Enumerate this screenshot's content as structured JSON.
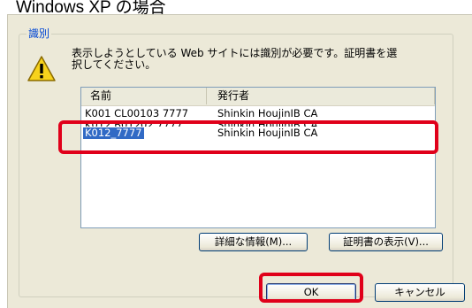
{
  "caption": "Windows XP の場合",
  "dialog": {
    "group_title": "識別",
    "message": "表示しようとしている Web サイトには識別が必要です。証明書を選択してください。",
    "icon": "warning-icon",
    "columns": [
      "名前",
      "発行者"
    ],
    "certificates": [
      {
        "name": "K001 CL00103 7777",
        "issuer": "Shinkin HoujinIB CA",
        "selected": false
      },
      {
        "name": "K012 B01202 7777",
        "issuer": "Shinkin HoujinIB CA",
        "selected": false
      },
      {
        "name": "K012_7777",
        "issuer": "Shinkin HoujinIB CA",
        "selected": true
      }
    ],
    "buttons": {
      "details": "詳細な情報(M)...",
      "view_cert": "証明書の表示(V)...",
      "ok": "OK",
      "cancel": "キャンセル"
    }
  },
  "colors": {
    "highlight": "#e0001a",
    "selection": "#316ac5",
    "dialog_bg": "#ece9d8"
  }
}
